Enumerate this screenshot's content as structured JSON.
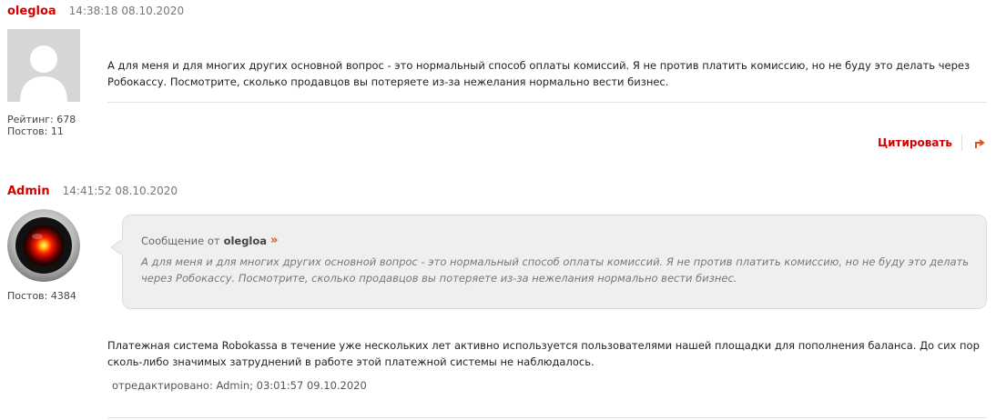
{
  "posts": [
    {
      "author": "olegloa",
      "time": "14:38:18 08.10.2020",
      "stats": {
        "rating": "Рейтинг: 678",
        "posts": "Постов: 11"
      },
      "text": "А для меня и для многих других основной вопрос - это нормальный способ оплаты комиссий. Я не против платить комиссию, но не буду это делать через Робокассу. Посмотрите, сколько продавцов вы потеряете из-за нежелания нормально вести бизнес.",
      "actions": {
        "quote_label": "Цитировать"
      }
    },
    {
      "author": "Admin",
      "time": "14:41:52 08.10.2020",
      "stats": {
        "posts": "Постов: 4384"
      },
      "quote": {
        "prefix": "Сообщение от",
        "author": "olegloa",
        "arrow": "»",
        "text": "А для меня и для многих других основной вопрос - это нормальный способ оплаты комиссий. Я не против платить комиссию, но не буду это делать через Робокассу. Посмотрите, сколько продавцов вы потеряете из-за нежелания нормально вести бизнес."
      },
      "text": "Платежная система Robokassa в течение уже нескольких лет активно используется пользователями нашей площадки для пополнения баланса. До сих пор сколь-либо значимых затруднений в работе этой платежной системы не наблюдалось.",
      "edited": "отредактировано: Admin; 03:01:57 09.10.2020"
    }
  ],
  "colors": {
    "accent": "#d40000",
    "arrow": "#e0501a",
    "quote_bg": "#efefef"
  },
  "icons": {
    "default_avatar": "user-silhouette-icon",
    "admin_avatar": "hal9000-eye-icon",
    "reply": "reply-arrow-icon",
    "quote_link": "double-chevron-right-icon"
  }
}
